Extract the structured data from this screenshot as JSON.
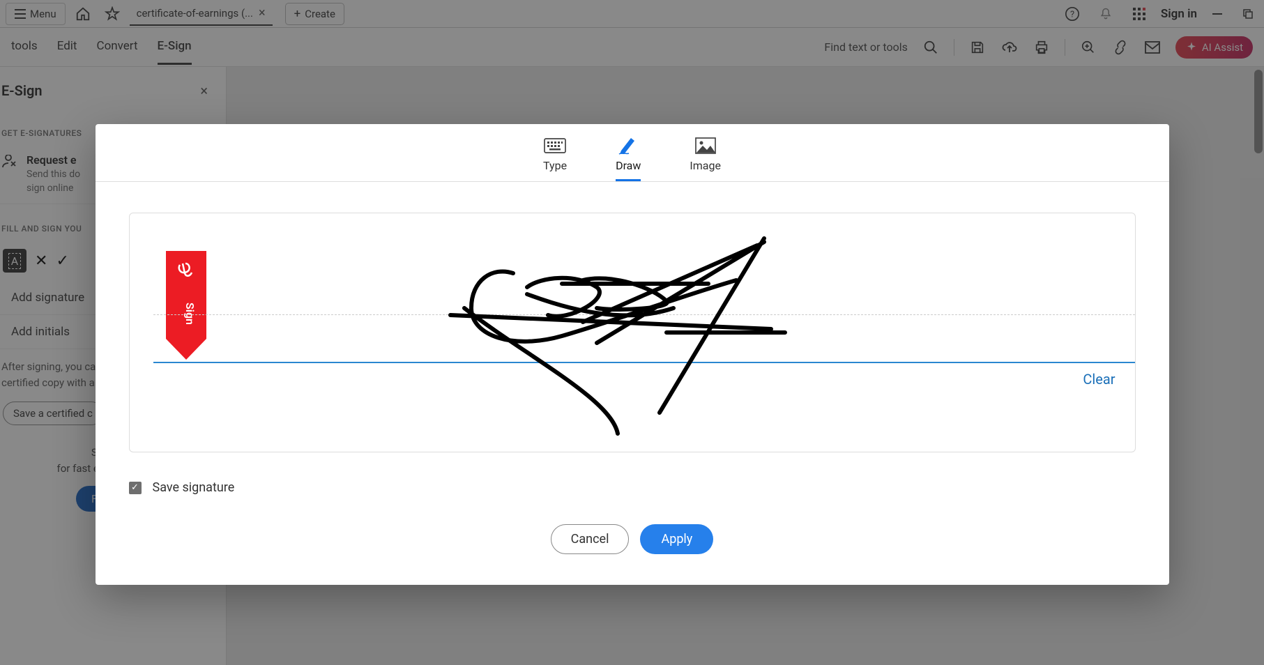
{
  "titlebar": {
    "menu_label": "Menu",
    "tab_title": "certificate-of-earnings (...",
    "create_label": "Create",
    "signin_label": "Sign in"
  },
  "toolbar": {
    "tabs": {
      "tools": "tools",
      "edit": "Edit",
      "convert": "Convert",
      "esign": "E-Sign"
    },
    "find_placeholder": "Find text or tools",
    "ai_assist_label": "AI Assist"
  },
  "sidebar": {
    "panel_title": "E-Sign",
    "section_get": "GET E-SIGNATURES",
    "request": {
      "title": "Request e",
      "desc": "Send this do\nsign online"
    },
    "section_fill": "FILL AND SIGN YOU",
    "add_signature": "Add signature",
    "add_initials": "Add initials",
    "after_text": "After signing, you ca\ncertified copy with a",
    "save_cert": "Save a certified c",
    "send_doc": "Send doc\nfor fast e-signing online.",
    "free_trial": "Free trial"
  },
  "modal": {
    "tabs": {
      "type": "Type",
      "draw": "Draw",
      "image": "Image"
    },
    "clear": "Clear",
    "save_signature": "Save signature",
    "cancel": "Cancel",
    "apply": "Apply",
    "flag_label": "Sign"
  }
}
